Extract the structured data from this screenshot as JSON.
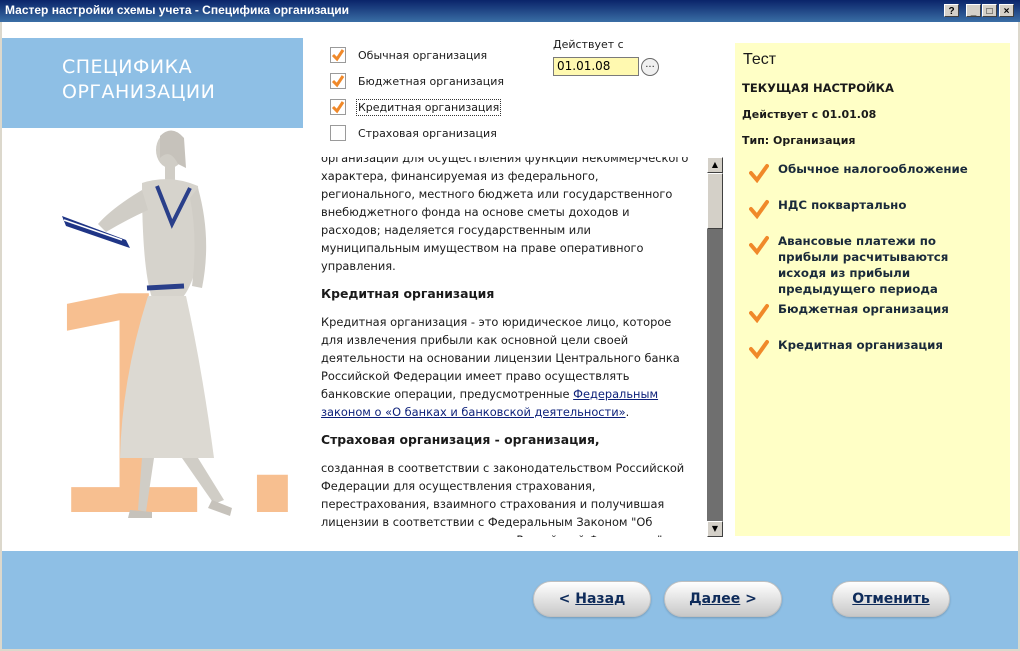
{
  "window": {
    "title": "Мастер настройки схемы учета - Специфика организации",
    "controls": [
      "?",
      "_",
      "□",
      "×"
    ]
  },
  "left_panel": {
    "heading": "СПЕЦИФИКА\nОРГАНИЗАЦИИ",
    "illustration_number": "1."
  },
  "options": [
    {
      "label": "Обычная организация",
      "checked": true
    },
    {
      "label": "Бюджетная организация",
      "checked": true
    },
    {
      "label": "Кредитная организация",
      "checked": true,
      "focused": true
    },
    {
      "label": "Страховая организация",
      "checked": false
    }
  ],
  "date": {
    "label": "Действует с",
    "value": "01.01.08",
    "button": "..."
  },
  "description": {
    "para1": "организации для осуществления функций некоммерческого характера, финансируемая из федерального, регионального, местного бюджета или государственного внебюджетного фонда на основе сметы доходов и расходов; наделяется государственным или муниципальным имуществом на праве оперативного управления.",
    "heading2": "Кредитная организация",
    "para2": "Кредитная организация - это юридическое лицо, которое для извлечения прибыли как основной цели своей деятельности на основании лицензии Центрального банка Российской Федерации имеет право осуществлять банковские операции, предусмотренные ",
    "link": "Федеральным законом о «О банках и банковской деятельности»",
    "para2_end": ".",
    "heading3": "Страховая организация - организация,",
    "para3": "созданная в соответствии с законодательством Российской Федерации для осуществления страхования, перестрахования, взаимного страхования и получившая лицензии в соответствии с Федеральным Законом \"Об организации страхового дела в Российской Федерации\""
  },
  "summary": {
    "title": "Тест",
    "subtitle": "ТЕКУЩАЯ НАСТРОЙКА",
    "date_line": "Действует с 01.01.08",
    "type_line": "Тип: Организация",
    "items": [
      "Обычное налогообложение",
      "НДС поквартально",
      "Авансовые платежи по прибыли расчитываются исходя из прибыли предыдущего периода",
      "Бюджетная организация",
      "Кредитная организация"
    ]
  },
  "buttons": {
    "back": {
      "arrow": "<",
      "label": "Назад"
    },
    "next": {
      "label": "Далее",
      "arrow": ">"
    },
    "cancel": {
      "label": "Отменить"
    }
  },
  "colors": {
    "title_bar": "#0a246a",
    "panel_blue": "#8ebfe5",
    "summary_bg": "#ffffc6",
    "check_orange": "#f0892a",
    "date_input_bg": "#fff9b0"
  }
}
